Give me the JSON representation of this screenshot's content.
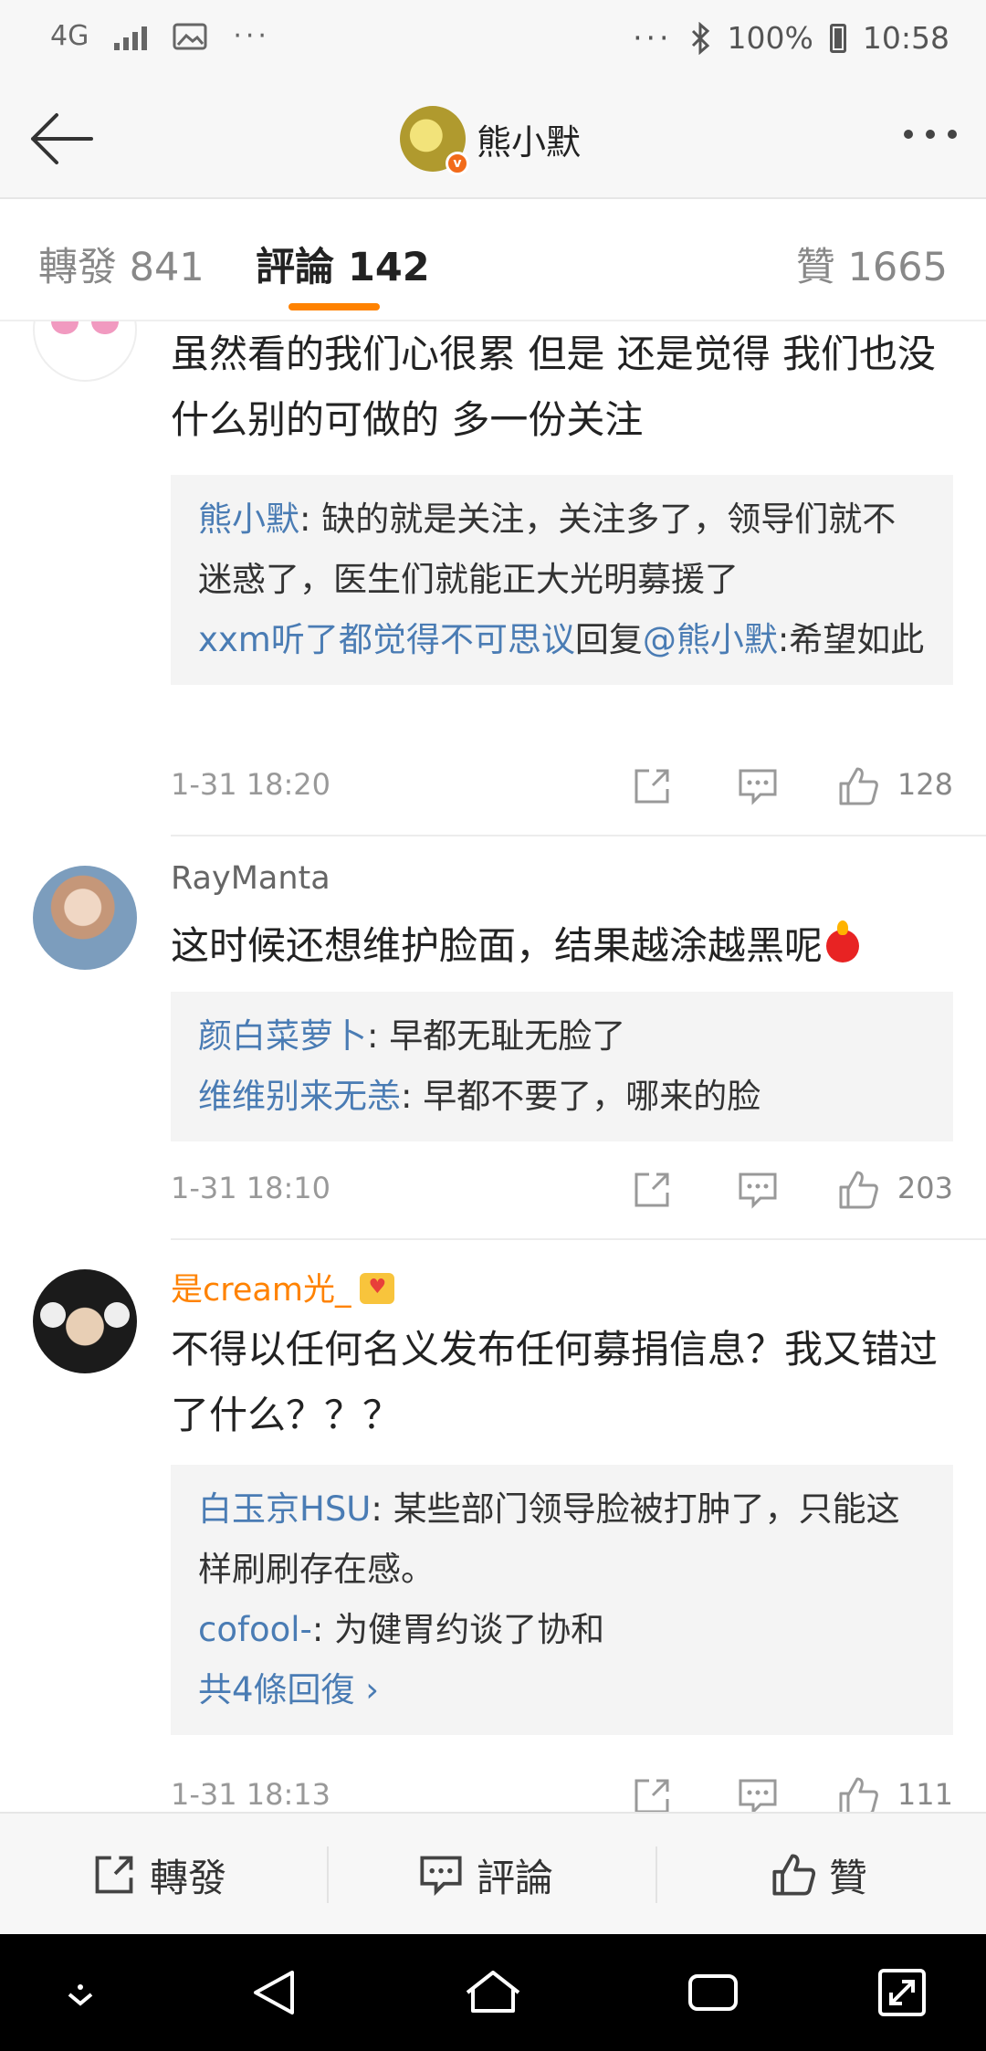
{
  "status_bar": {
    "network": "4G",
    "battery": "100%",
    "time": "10:58",
    "icons": [
      "signal-icon",
      "image-icon",
      "more-dots-icon",
      "bluetooth-icon",
      "battery-icon"
    ]
  },
  "nav": {
    "title": "熊小默",
    "icons": [
      "back-arrow-icon",
      "verified-badge-icon",
      "more-icon"
    ]
  },
  "tabs": [
    {
      "label": "轉發 841",
      "active": false
    },
    {
      "label": "評論 142",
      "active": true
    },
    {
      "label": "贊 1665",
      "active": false
    }
  ],
  "comments": [
    {
      "name": "",
      "text": "虽然看的我们心很累 但是 还是觉得 我们也没什么别的可做的 多一份关注",
      "replies": [
        {
          "user": "熊小默",
          "sep": ": ",
          "text": "缺的就是关注，关注多了，领导们就不迷惑了，医生们就能正大光明募援了"
        },
        {
          "user": "xxm听了都觉得不可思议",
          "mid": "回复",
          "mention": "@熊小默",
          "text": ":希望如此"
        }
      ],
      "time": "1-31 18:20",
      "likes": "128"
    },
    {
      "name": "RayManta",
      "text": "这时候还想维护脸面，结果越涂越黑呢",
      "replies": [
        {
          "user": "颜白菜萝卜",
          "sep": ": ",
          "text": "早都无耻无脸了"
        },
        {
          "user": "维维别来无恙",
          "sep": ": ",
          "text": "早都不要了，哪来的脸"
        }
      ],
      "time": "1-31 18:10",
      "likes": "203"
    },
    {
      "name": "是cream光_",
      "text": "不得以任何名义发布任何募捐信息？我又错过了什么？？？",
      "replies": [
        {
          "user": "白玉京HSU",
          "sep": ": ",
          "text": "某些部门领导脸被打肿了，只能这样刷刷存在感。"
        },
        {
          "user": "cofool-",
          "sep": ": ",
          "text": "为健胃约谈了协和"
        }
      ],
      "more_replies": "共4條回復 ›",
      "time": "1-31 18:13",
      "likes": "111"
    }
  ],
  "bottom_bar": {
    "repost": "轉發",
    "comment": "評論",
    "like": "贊"
  },
  "colors": {
    "accent": "#ff8200",
    "link": "#4a7cb4",
    "vip_name": "#ff8200"
  }
}
